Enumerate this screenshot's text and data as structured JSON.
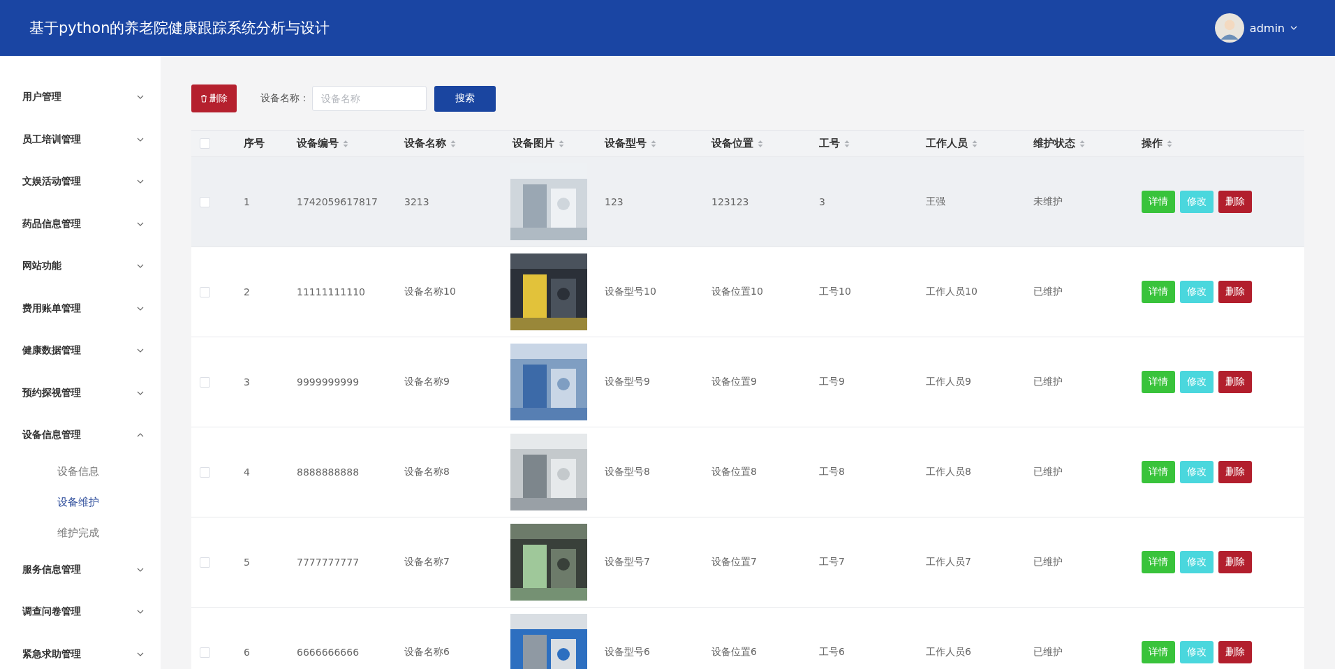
{
  "header": {
    "title": "基于python的养老院健康跟踪系统分析与设计",
    "user": {
      "name": "admin"
    }
  },
  "sidebar": {
    "items": [
      {
        "label": "用户管理",
        "expanded": false
      },
      {
        "label": "员工培训管理",
        "expanded": false
      },
      {
        "label": "文娱活动管理",
        "expanded": false
      },
      {
        "label": "药品信息管理",
        "expanded": false
      },
      {
        "label": "网站功能",
        "expanded": false
      },
      {
        "label": "费用账单管理",
        "expanded": false
      },
      {
        "label": "健康数据管理",
        "expanded": false
      },
      {
        "label": "预约探视管理",
        "expanded": false
      },
      {
        "label": "设备信息管理",
        "expanded": true,
        "children": [
          {
            "label": "设备信息",
            "selected": false
          },
          {
            "label": "设备维护",
            "selected": true
          },
          {
            "label": "维护完成",
            "selected": false
          }
        ]
      },
      {
        "label": "服务信息管理",
        "expanded": false
      },
      {
        "label": "调查问卷管理",
        "expanded": false
      },
      {
        "label": "紧急求助管理",
        "expanded": false
      }
    ]
  },
  "toolbar": {
    "delete_button": "删除",
    "search_label": "设备名称：",
    "search_placeholder": "设备名称",
    "search_button": "搜索"
  },
  "table": {
    "select_all_checked": false,
    "columns": [
      {
        "label": "序号",
        "sortable": false
      },
      {
        "label": "设备编号",
        "sortable": true
      },
      {
        "label": "设备名称",
        "sortable": true
      },
      {
        "label": "设备图片",
        "sortable": true
      },
      {
        "label": "设备型号",
        "sortable": true
      },
      {
        "label": "设备位置",
        "sortable": true
      },
      {
        "label": "工号",
        "sortable": true
      },
      {
        "label": "工作人员",
        "sortable": true
      },
      {
        "label": "维护状态",
        "sortable": true
      },
      {
        "label": "操作",
        "sortable": true
      }
    ],
    "rows": [
      {
        "checked": false,
        "hovered": true,
        "cells": [
          "1",
          "1742059617817",
          "3213",
          {
            "kind": "picture"
          },
          "123",
          "123123",
          "3",
          "王强",
          "未维护"
        ],
        "actions": [
          {
            "kind": "detail",
            "label": "详情"
          },
          {
            "kind": "edit",
            "label": "修改"
          },
          {
            "kind": "delete",
            "label": "删除"
          }
        ]
      },
      {
        "checked": false,
        "hovered": false,
        "cells": [
          "2",
          "11111111110",
          "设备名称10",
          {
            "kind": "picture"
          },
          "设备型号10",
          "设备位置10",
          "工号10",
          "工作人员10",
          "已维护"
        ],
        "actions": [
          {
            "kind": "detail",
            "label": "详情"
          },
          {
            "kind": "edit",
            "label": "修改"
          },
          {
            "kind": "delete",
            "label": "删除"
          }
        ]
      },
      {
        "checked": false,
        "hovered": false,
        "cells": [
          "3",
          "9999999999",
          "设备名称9",
          {
            "kind": "picture"
          },
          "设备型号9",
          "设备位置9",
          "工号9",
          "工作人员9",
          "已维护"
        ],
        "actions": [
          {
            "kind": "detail",
            "label": "详情"
          },
          {
            "kind": "edit",
            "label": "修改"
          },
          {
            "kind": "delete",
            "label": "删除"
          }
        ]
      },
      {
        "checked": false,
        "hovered": false,
        "cells": [
          "4",
          "8888888888",
          "设备名称8",
          {
            "kind": "picture"
          },
          "设备型号8",
          "设备位置8",
          "工号8",
          "工作人员8",
          "已维护"
        ],
        "actions": [
          {
            "kind": "detail",
            "label": "详情"
          },
          {
            "kind": "edit",
            "label": "修改"
          },
          {
            "kind": "delete",
            "label": "删除"
          }
        ]
      },
      {
        "checked": false,
        "hovered": false,
        "cells": [
          "5",
          "7777777777",
          "设备名称7",
          {
            "kind": "picture"
          },
          "设备型号7",
          "设备位置7",
          "工号7",
          "工作人员7",
          "已维护"
        ],
        "actions": [
          {
            "kind": "detail",
            "label": "详情"
          },
          {
            "kind": "edit",
            "label": "修改"
          },
          {
            "kind": "delete",
            "label": "删除"
          }
        ]
      },
      {
        "checked": false,
        "hovered": false,
        "cells": [
          "6",
          "6666666666",
          "设备名称6",
          {
            "kind": "picture"
          },
          "设备型号6",
          "设备位置6",
          "工号6",
          "工作人员6",
          "已维护"
        ],
        "actions": [
          {
            "kind": "detail",
            "label": "详情"
          },
          {
            "kind": "edit",
            "label": "修改"
          },
          {
            "kind": "delete",
            "label": "删除"
          }
        ]
      }
    ]
  }
}
